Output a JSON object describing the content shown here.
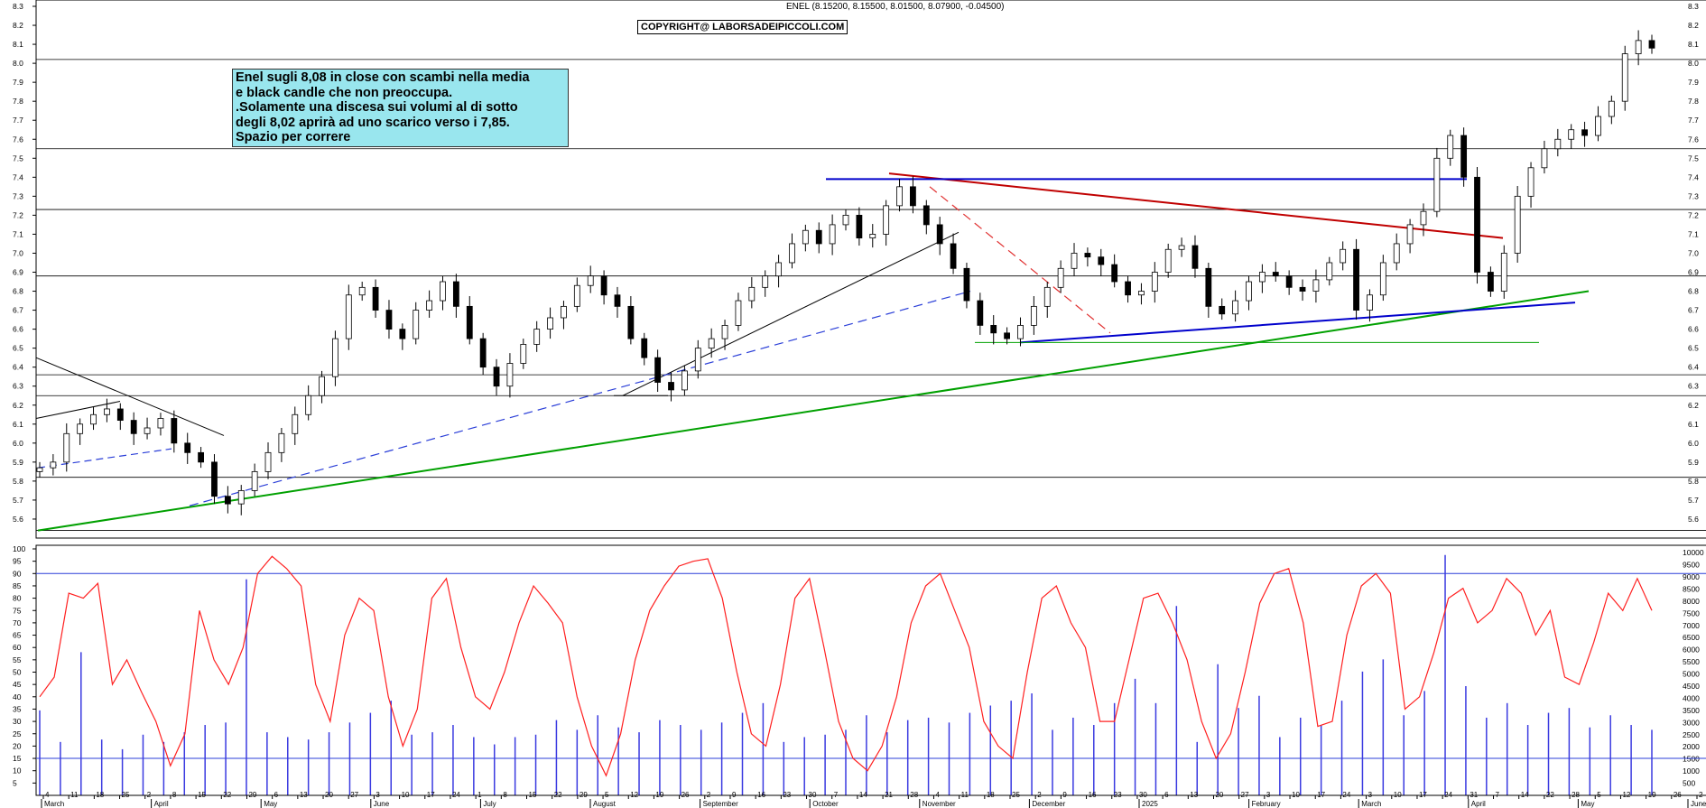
{
  "header": {
    "title": "ENEL (8.15200, 8.15500, 8.01500, 8.07900, -0.04500)",
    "copyright": "COPYRIGHT@ LABORSADEIPICCOLI.COM"
  },
  "annotation": {
    "lines": [
      "Enel sugli 8,08 in close con scambi nella media",
      "e black candle che non preoccupa.",
      ".Solamente una discesa sui volumi al di sotto",
      "degli 8,02 aprirà ad uno scarico verso i 7,85.",
      "Spazio per correre"
    ]
  },
  "chart_data": [
    {
      "type": "candlestick",
      "title": "ENEL (8.15200, 8.15500, 8.01500, 8.07900, -0.04500)",
      "ylim": [
        5.5,
        8.3
      ],
      "y_ticks": [
        "5.6",
        "5.7",
        "5.8",
        "5.9",
        "6.0",
        "6.1",
        "6.2",
        "6.3",
        "6.4",
        "6.5",
        "6.6",
        "6.7",
        "6.8",
        "6.9",
        "7.0",
        "7.1",
        "7.2",
        "7.3",
        "7.4",
        "7.5",
        "7.6",
        "7.7",
        "7.8",
        "7.9",
        "8.0",
        "8.1",
        "8.2",
        "8.3"
      ],
      "horizontal_levels": [
        5.54,
        5.82,
        6.25,
        6.36,
        6.88,
        7.23,
        7.55,
        8.02
      ],
      "last_bar": {
        "open": 8.152,
        "high": 8.155,
        "low": 8.015,
        "close": 8.079,
        "change": -0.045
      },
      "closes_sampled": [
        5.87,
        5.9,
        6.05,
        6.1,
        6.15,
        6.18,
        6.12,
        6.05,
        6.08,
        6.13,
        6.0,
        5.95,
        5.9,
        5.72,
        5.68,
        5.75,
        5.85,
        5.95,
        6.05,
        6.15,
        6.25,
        6.35,
        6.55,
        6.78,
        6.82,
        6.7,
        6.6,
        6.55,
        6.7,
        6.75,
        6.85,
        6.72,
        6.55,
        6.4,
        6.3,
        6.42,
        6.52,
        6.6,
        6.66,
        6.72,
        6.83,
        6.88,
        6.78,
        6.72,
        6.55,
        6.45,
        6.32,
        6.28,
        6.38,
        6.5,
        6.55,
        6.62,
        6.75,
        6.82,
        6.88,
        6.95,
        7.05,
        7.12,
        7.05,
        7.15,
        7.2,
        7.08,
        7.1,
        7.25,
        7.35,
        7.25,
        7.15,
        7.05,
        6.92,
        6.75,
        6.62,
        6.58,
        6.55,
        6.62,
        6.72,
        6.82,
        6.92,
        7.0,
        6.98,
        6.94,
        6.85,
        6.78,
        6.8,
        6.9,
        7.02,
        7.04,
        6.92,
        6.72,
        6.68,
        6.75,
        6.85,
        6.9,
        6.88,
        6.82,
        6.8,
        6.86,
        6.95,
        7.02,
        6.7,
        6.78,
        6.95,
        7.05,
        7.15,
        7.22,
        7.5,
        7.62,
        7.4,
        6.9,
        6.8,
        7.0,
        7.3,
        7.45,
        7.55,
        7.6,
        7.65,
        7.62,
        7.72,
        7.8,
        8.05,
        8.12,
        8.08
      ],
      "trendlines": [
        {
          "color": "#00a000",
          "from": {
            "x": "Mar 2024",
            "y": 5.54
          },
          "to": {
            "x": "Apr 2025",
            "y": 6.8
          }
        },
        {
          "color": "#c00000",
          "from": {
            "x": "Oct 14 2024",
            "y": 7.42
          },
          "to": {
            "x": "Feb 2025",
            "y": 7.08
          }
        },
        {
          "color": "#0000cc",
          "from": {
            "x": "Oct 2024",
            "y": 7.39
          },
          "to": {
            "x": "Mar 2025",
            "y": 7.39
          }
        },
        {
          "color": "#0000cc",
          "from": {
            "x": "Nov 2024",
            "y": 6.53
          },
          "to": {
            "x": "Apr 2025",
            "y": 6.74
          }
        }
      ]
    },
    {
      "type": "line+bar",
      "ylim": [
        0,
        100
      ],
      "y_ticks": [
        "5",
        "10",
        "15",
        "20",
        "25",
        "30",
        "35",
        "40",
        "45",
        "50",
        "55",
        "60",
        "65",
        "70",
        "75",
        "80",
        "85",
        "90",
        "95",
        "100"
      ],
      "right_ticks": [
        "500",
        "1000",
        "1500",
        "2000",
        "2500",
        "3000",
        "3500",
        "4000",
        "4500",
        "5000",
        "5500",
        "6000",
        "6500",
        "7000",
        "7500",
        "8000",
        "8500",
        "9000",
        "9500",
        "10000"
      ],
      "levels": [
        15,
        90
      ],
      "oscillator_sampled": [
        40,
        48,
        82,
        80,
        86,
        45,
        55,
        42,
        30,
        12,
        25,
        75,
        55,
        45,
        60,
        90,
        97,
        92,
        85,
        45,
        30,
        65,
        80,
        75,
        40,
        20,
        35,
        80,
        88,
        60,
        40,
        35,
        50,
        70,
        85,
        78,
        70,
        40,
        20,
        8,
        25,
        55,
        75,
        85,
        93,
        95,
        96,
        80,
        50,
        25,
        20,
        45,
        80,
        88,
        60,
        30,
        15,
        10,
        20,
        40,
        70,
        85,
        90,
        75,
        60,
        30,
        20,
        15,
        50,
        80,
        85,
        70,
        60,
        30,
        30,
        55,
        80,
        82,
        70,
        55,
        30,
        15,
        25,
        50,
        78,
        90,
        92,
        70,
        28,
        30,
        65,
        85,
        90,
        82,
        35,
        40,
        58,
        80,
        84,
        70,
        75,
        88,
        82,
        65,
        75,
        48,
        45,
        62,
        82,
        75,
        88,
        75
      ],
      "volume_sampled_k": [
        3500,
        2200,
        5900,
        2300,
        1900,
        2500,
        2200,
        2600,
        2900,
        3000,
        8900,
        2600,
        2400,
        2300,
        2600,
        3000,
        3400,
        3900,
        2500,
        2600,
        2900,
        2400,
        2100,
        2400,
        2500,
        3100,
        2700,
        3300,
        2800,
        2600,
        3100,
        2900,
        2700,
        3000,
        3400,
        3800,
        2200,
        2400,
        2500,
        2700,
        3300,
        2600,
        3100,
        3200,
        3000,
        3400,
        3700,
        3900,
        4200,
        2700,
        3200,
        2900,
        3800,
        4800,
        3800,
        7800,
        2200,
        5400,
        3600,
        4100,
        2400,
        3200,
        2900,
        3900,
        5100,
        5600,
        3300,
        4300,
        9900,
        4500,
        3200,
        3800,
        2900,
        3400,
        3600,
        2800,
        3300,
        2900,
        2700
      ]
    }
  ],
  "x_axis": {
    "day_labels": [
      "4",
      "11",
      "18",
      "25",
      "2",
      "8",
      "15",
      "22",
      "29",
      "6",
      "13",
      "20",
      "27",
      "3",
      "10",
      "17",
      "24",
      "1",
      "8",
      "15",
      "22",
      "29",
      "5",
      "12",
      "19",
      "26",
      "2",
      "9",
      "16",
      "23",
      "30",
      "7",
      "14",
      "21",
      "28",
      "4",
      "11",
      "18",
      "25",
      "2",
      "9",
      "16",
      "23",
      "30",
      "6",
      "13",
      "20",
      "27",
      "3",
      "10",
      "17",
      "24",
      "3",
      "10",
      "17",
      "24",
      "31",
      "7",
      "14",
      "22",
      "28",
      "5",
      "12",
      "19",
      "26",
      "2"
    ],
    "month_labels": [
      "March",
      "April",
      "May",
      "June",
      "July",
      "August",
      "September",
      "October",
      "November",
      "December",
      "2025",
      "February",
      "March",
      "April",
      "May",
      "June"
    ]
  }
}
